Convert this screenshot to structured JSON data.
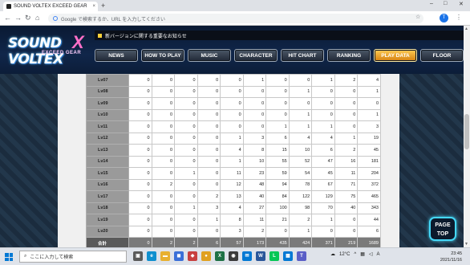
{
  "browser": {
    "tab_title": "SOUND VOLTEX EXCEED GEAR",
    "tab_close": "×",
    "new_tab": "+",
    "window_controls": [
      "–",
      "□",
      "✕"
    ],
    "back": "←",
    "forward": "→",
    "reload": "↻",
    "home": "⌂",
    "address_placeholder": "Google で検索するか、URL を入力してください",
    "star": "☆",
    "profile_initial": "T",
    "menu": "⋮"
  },
  "site": {
    "logo_text": "SOUND VOLTEX",
    "logo_sub": "EXCEED GEAR",
    "logo_x": "X",
    "notice": "新バージョンに関する重要なお知らせ",
    "nav": [
      {
        "label": "NEWS",
        "active": false
      },
      {
        "label": "HOW TO PLAY",
        "active": false
      },
      {
        "label": "MUSIC",
        "active": false
      },
      {
        "label": "CHARACTER",
        "active": false
      },
      {
        "label": "HIT CHART",
        "active": false
      },
      {
        "label": "RANKING",
        "active": false
      },
      {
        "label": "PLAY DATA",
        "active": true
      },
      {
        "label": "FLOOR",
        "active": false
      }
    ],
    "page_top": [
      "PAGE",
      "TOP"
    ]
  },
  "table": {
    "rows": [
      {
        "label": "Lv07",
        "values": [
          "0",
          "0",
          "0",
          "0",
          "0",
          "1",
          "0",
          "0",
          "1",
          "2",
          "4"
        ]
      },
      {
        "label": "Lv08",
        "values": [
          "0",
          "0",
          "0",
          "0",
          "0",
          "0",
          "0",
          "1",
          "0",
          "0",
          "1"
        ]
      },
      {
        "label": "Lv09",
        "values": [
          "0",
          "0",
          "0",
          "0",
          "0",
          "0",
          "0",
          "0",
          "0",
          "0",
          "0"
        ]
      },
      {
        "label": "Lv10",
        "values": [
          "0",
          "0",
          "0",
          "0",
          "0",
          "0",
          "0",
          "1",
          "0",
          "0",
          "1"
        ]
      },
      {
        "label": "Lv11",
        "values": [
          "0",
          "0",
          "0",
          "0",
          "0",
          "0",
          "1",
          "1",
          "1",
          "0",
          "3"
        ]
      },
      {
        "label": "Lv12",
        "values": [
          "0",
          "0",
          "0",
          "0",
          "1",
          "3",
          "6",
          "4",
          "4",
          "1",
          "19"
        ]
      },
      {
        "label": "Lv13",
        "values": [
          "0",
          "0",
          "0",
          "0",
          "4",
          "8",
          "15",
          "10",
          "6",
          "2",
          "45"
        ]
      },
      {
        "label": "Lv14",
        "values": [
          "0",
          "0",
          "0",
          "0",
          "1",
          "10",
          "55",
          "52",
          "47",
          "16",
          "181"
        ]
      },
      {
        "label": "Lv15",
        "values": [
          "0",
          "0",
          "1",
          "0",
          "11",
          "23",
          "59",
          "54",
          "45",
          "11",
          "204"
        ]
      },
      {
        "label": "Lv16",
        "values": [
          "0",
          "2",
          "0",
          "0",
          "12",
          "48",
          "94",
          "78",
          "67",
          "71",
          "372"
        ]
      },
      {
        "label": "Lv17",
        "values": [
          "0",
          "0",
          "0",
          "2",
          "13",
          "40",
          "84",
          "122",
          "129",
          "75",
          "465"
        ]
      },
      {
        "label": "Lv18",
        "values": [
          "0",
          "0",
          "1",
          "3",
          "4",
          "27",
          "100",
          "98",
          "70",
          "40",
          "343"
        ]
      },
      {
        "label": "Lv19",
        "values": [
          "0",
          "0",
          "0",
          "1",
          "8",
          "11",
          "21",
          "2",
          "1",
          "0",
          "44"
        ]
      },
      {
        "label": "Lv20",
        "values": [
          "0",
          "0",
          "0",
          "0",
          "3",
          "2",
          "0",
          "1",
          "0",
          "0",
          "6"
        ]
      }
    ],
    "total": {
      "label": "合計",
      "values": [
        "0",
        "2",
        "2",
        "6",
        "57",
        "173",
        "435",
        "424",
        "371",
        "219",
        "1689"
      ]
    }
  },
  "taskbar": {
    "search_placeholder": "ここに入力して検索",
    "apps": [
      {
        "name": "task-view-icon",
        "glyph": "▣",
        "color": "#5a5a5a"
      },
      {
        "name": "edge-icon",
        "glyph": "e",
        "color": "#0f8fcf"
      },
      {
        "name": "folder-icon",
        "glyph": "▬",
        "color": "#e8b030"
      },
      {
        "name": "store-icon",
        "glyph": "◼",
        "color": "#3a6fd8"
      },
      {
        "name": "photos-icon",
        "glyph": "◆",
        "color": "#c84040"
      },
      {
        "name": "chrome-icon",
        "glyph": "●",
        "color": "#e0a020"
      },
      {
        "name": "excel-icon",
        "glyph": "X",
        "color": "#1e7145"
      },
      {
        "name": "app-icon",
        "glyph": "◉",
        "color": "#3a3a3a"
      },
      {
        "name": "mail-icon",
        "glyph": "✉",
        "color": "#0078d4"
      },
      {
        "name": "word-icon",
        "glyph": "W",
        "color": "#2b579a"
      },
      {
        "name": "line-icon",
        "glyph": "L",
        "color": "#06c755"
      },
      {
        "name": "calendar-icon",
        "glyph": "▦",
        "color": "#0078d4"
      },
      {
        "name": "teams-icon",
        "glyph": "T",
        "color": "#5b5fc7"
      }
    ],
    "weather": "12°C",
    "time": "23:45",
    "date": "2021/11/16"
  }
}
